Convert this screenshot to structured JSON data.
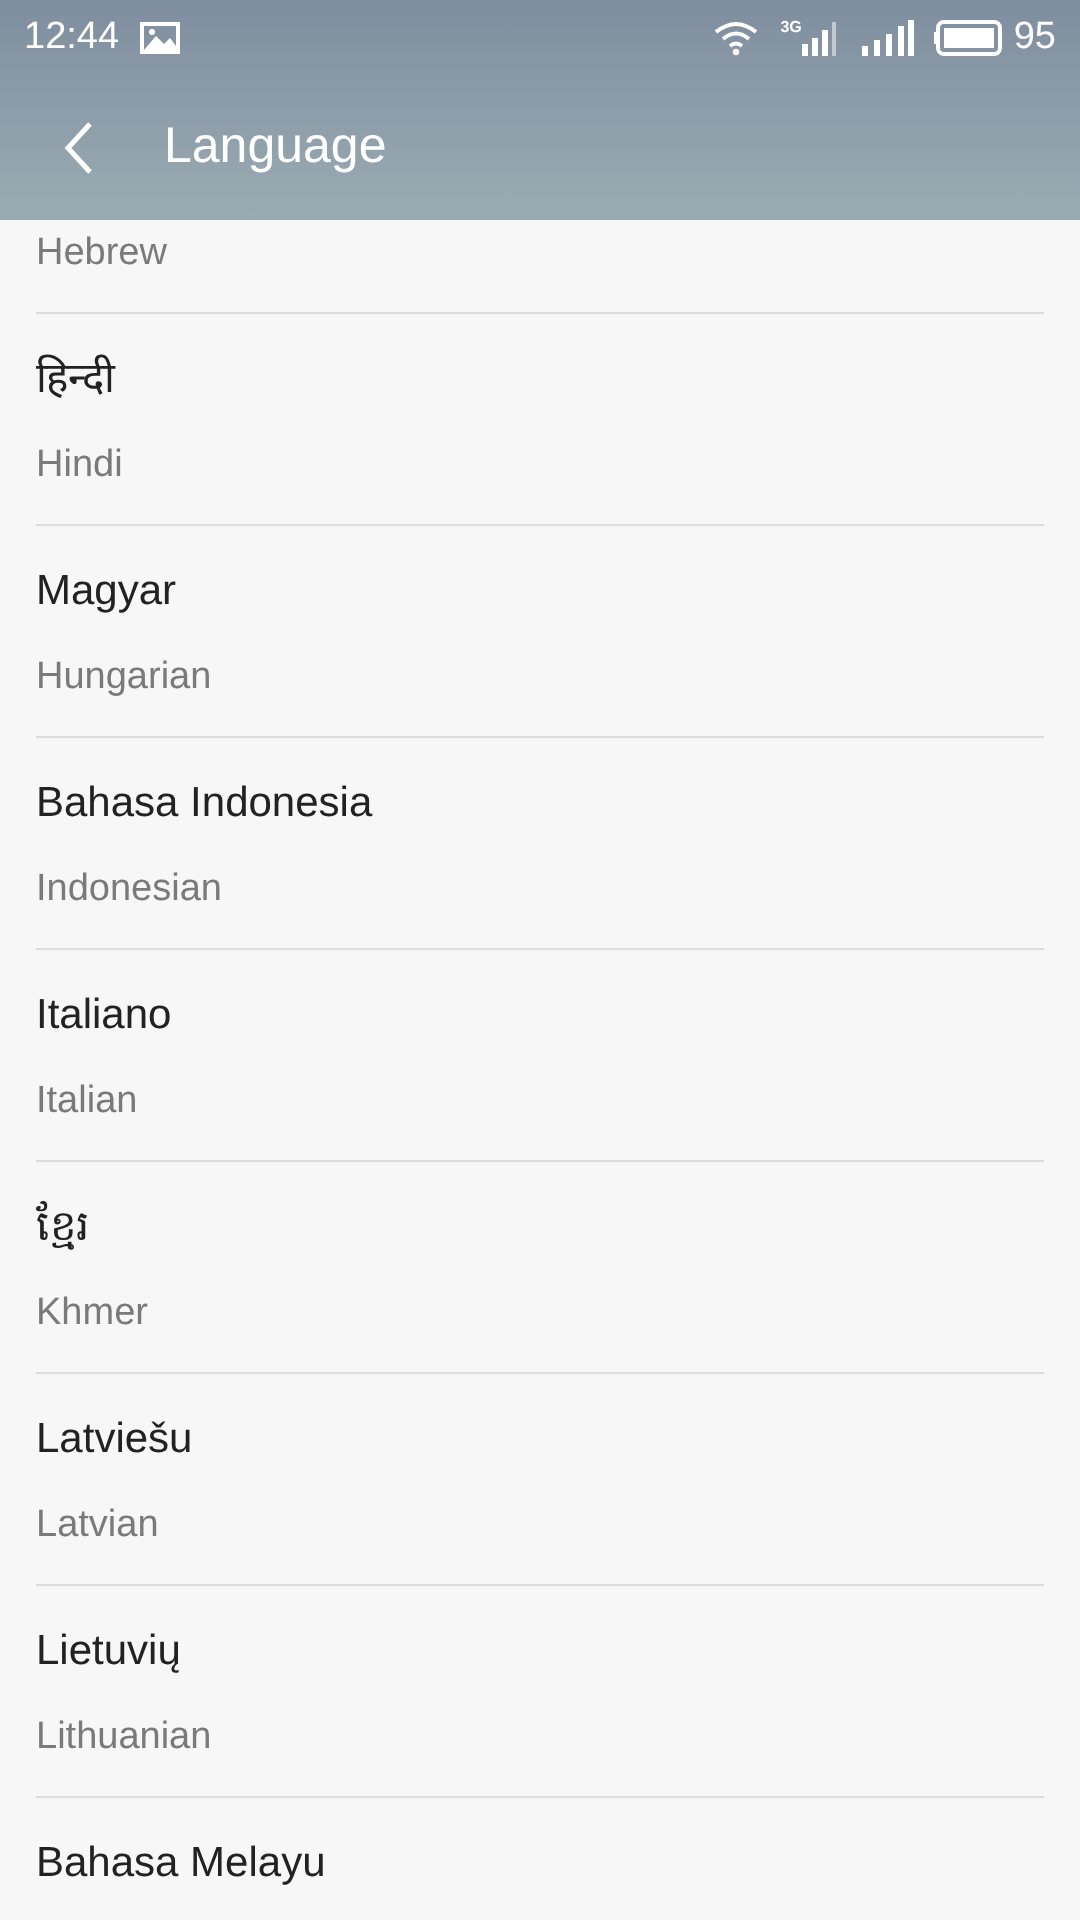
{
  "status_bar": {
    "time": "12:44",
    "network": "3G",
    "battery": "95"
  },
  "header": {
    "title": "Language"
  },
  "languages": [
    {
      "english": "Hebrew"
    },
    {
      "native": "हिन्दी",
      "english": "Hindi"
    },
    {
      "native": "Magyar",
      "english": "Hungarian"
    },
    {
      "native": "Bahasa Indonesia",
      "english": "Indonesian"
    },
    {
      "native": "Italiano",
      "english": "Italian"
    },
    {
      "native": "ខ្មែរ",
      "english": "Khmer"
    },
    {
      "native": "Latviešu",
      "english": "Latvian"
    },
    {
      "native": "Lietuvių",
      "english": "Lithuanian"
    },
    {
      "native": "Bahasa Melayu"
    }
  ]
}
